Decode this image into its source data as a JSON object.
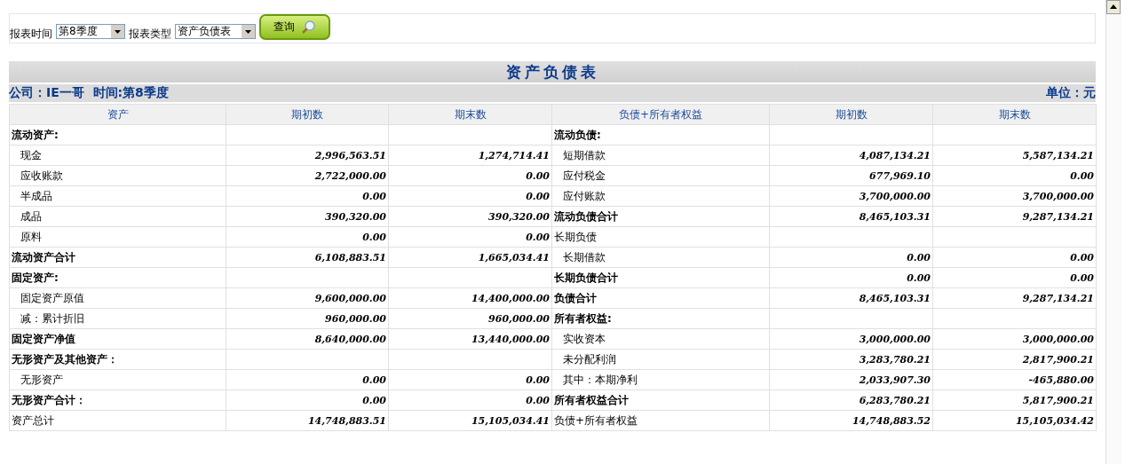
{
  "filter": {
    "time_label": "报表时间",
    "time_value": "第8季度",
    "type_label": "报表类型",
    "type_value": "资产负债表",
    "query_button": "查询"
  },
  "report": {
    "title": "资产负债表",
    "company": "公司：IE一哥  时间:第8季度",
    "unit": "单位：元",
    "columns": [
      "资产",
      "期初数",
      "期末数",
      "负债+所有者权益",
      "期初数",
      "期末数"
    ],
    "rows": [
      {
        "left": {
          "label": "流动资产:",
          "kind": "header"
        },
        "right": {
          "label": "流动负债:",
          "kind": "header"
        }
      },
      {
        "left": {
          "label": "现金",
          "kind": "item",
          "begin": "2,996,563.51",
          "end": "1,274,714.41"
        },
        "right": {
          "label": "短期借款",
          "kind": "item",
          "begin": "4,087,134.21",
          "end": "5,587,134.21"
        }
      },
      {
        "left": {
          "label": "应收账款",
          "kind": "item",
          "begin": "2,722,000.00",
          "end": "0.00"
        },
        "right": {
          "label": "应付税金",
          "kind": "item",
          "begin": "677,969.10",
          "end": "0.00"
        }
      },
      {
        "left": {
          "label": "半成品",
          "kind": "item",
          "begin": "0.00",
          "end": "0.00"
        },
        "right": {
          "label": "应付账款",
          "kind": "item",
          "begin": "3,700,000.00",
          "end": "3,700,000.00"
        }
      },
      {
        "left": {
          "label": "成品",
          "kind": "item",
          "begin": "390,320.00",
          "end": "390,320.00"
        },
        "right": {
          "label": "流动负债合计",
          "kind": "total",
          "begin": "8,465,103.31",
          "end": "9,287,134.21"
        }
      },
      {
        "left": {
          "label": "原料",
          "kind": "item",
          "begin": "0.00",
          "end": "0.00"
        },
        "right": {
          "label": "长期负债",
          "kind": "plain"
        }
      },
      {
        "left": {
          "label": "流动资产合计",
          "kind": "total",
          "begin": "6,108,883.51",
          "end": "1,665,034.41"
        },
        "right": {
          "label": "长期借款",
          "kind": "item",
          "begin": "0.00",
          "end": "0.00"
        }
      },
      {
        "left": {
          "label": "固定资产:",
          "kind": "header"
        },
        "right": {
          "label": "长期负债合计",
          "kind": "total",
          "begin": "0.00",
          "end": "0.00"
        }
      },
      {
        "left": {
          "label": "固定资产原值",
          "kind": "item",
          "begin": "9,600,000.00",
          "end": "14,400,000.00"
        },
        "right": {
          "label": "负债合计",
          "kind": "total",
          "begin": "8,465,103.31",
          "end": "9,287,134.21"
        }
      },
      {
        "left": {
          "label": "减：累计折旧",
          "kind": "item",
          "begin": "960,000.00",
          "end": "960,000.00"
        },
        "right": {
          "label": "所有者权益:",
          "kind": "header"
        }
      },
      {
        "left": {
          "label": "固定资产净值",
          "kind": "total",
          "begin": "8,640,000.00",
          "end": "13,440,000.00"
        },
        "right": {
          "label": "实收资本",
          "kind": "item",
          "begin": "3,000,000.00",
          "end": "3,000,000.00"
        }
      },
      {
        "left": {
          "label": "无形资产及其他资产：",
          "kind": "header"
        },
        "right": {
          "label": "未分配利润",
          "kind": "item",
          "begin": "3,283,780.21",
          "end": "2,817,900.21"
        }
      },
      {
        "left": {
          "label": "无形资产",
          "kind": "item",
          "begin": "0.00",
          "end": "0.00"
        },
        "right": {
          "label": "其中：本期净利",
          "kind": "item",
          "begin": "2,033,907.30",
          "end": "-465,880.00"
        }
      },
      {
        "left": {
          "label": "无形资产合计：",
          "kind": "total",
          "begin": "0.00",
          "end": "0.00"
        },
        "right": {
          "label": "所有者权益合计",
          "kind": "total",
          "begin": "6,283,780.21",
          "end": "5,817,900.21"
        }
      },
      {
        "left": {
          "label": "资产总计",
          "kind": "plain",
          "begin": "14,748,883.51",
          "end": "15,105,034.41"
        },
        "right": {
          "label": "负债+所有者权益",
          "kind": "plain",
          "begin": "14,748,883.52",
          "end": "15,105,034.42"
        }
      }
    ]
  }
}
